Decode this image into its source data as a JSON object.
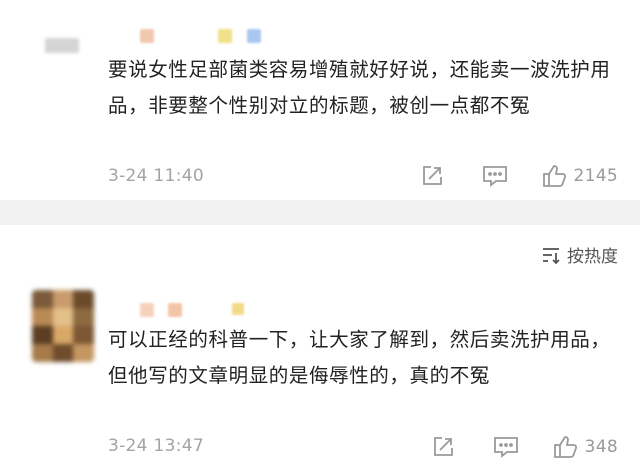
{
  "comments": [
    {
      "text": "要说女性足部菌类容易增殖就好好说，还能卖一波洗护用品，非要整个性别对立的标题，被创一点都不冤",
      "time": "3-24 11:40",
      "likes": "2145",
      "share_icon": "share-edit-icon",
      "reply_icon": "comment-icon",
      "like_icon": "thumbs-up-icon"
    },
    {
      "text": "可以正经的科普一下，让大家了解到，然后卖洗护用品，但他写的文章明显的是侮辱性的，真的不冤",
      "time": "3-24 13:47",
      "likes": "348",
      "share_icon": "share-edit-icon",
      "reply_icon": "comment-icon",
      "like_icon": "thumbs-up-icon"
    }
  ],
  "sort": {
    "label": "按热度",
    "icon": "sort-icon"
  },
  "colors": {
    "text": "#222222",
    "meta": "#a3a3a3",
    "icon": "#9a9a9a",
    "separator": "#f2f2f2"
  }
}
